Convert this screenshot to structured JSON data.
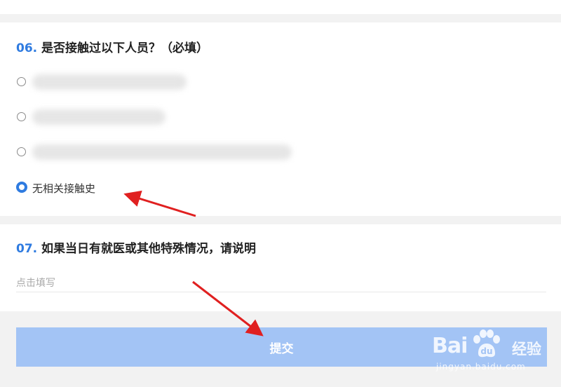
{
  "question6": {
    "number": "06.",
    "text": "是否接触过以下人员？（必填）",
    "options": [
      {
        "label": "",
        "selected": false
      },
      {
        "label": "",
        "selected": false
      },
      {
        "label": "",
        "selected": false
      },
      {
        "label": "无相关接触史",
        "selected": true
      }
    ]
  },
  "question7": {
    "number": "07.",
    "text": "如果当日有就医或其他特殊情况，请说明",
    "placeholder": "点击填写"
  },
  "submit": {
    "label": "提交"
  },
  "watermark": {
    "brand": "Bai",
    "product": "经验",
    "url": "jingyan.baidu.com"
  },
  "colors": {
    "accent": "#2f7be0",
    "submit_bg": "#a3c4f5",
    "arrow": "#e02020"
  }
}
